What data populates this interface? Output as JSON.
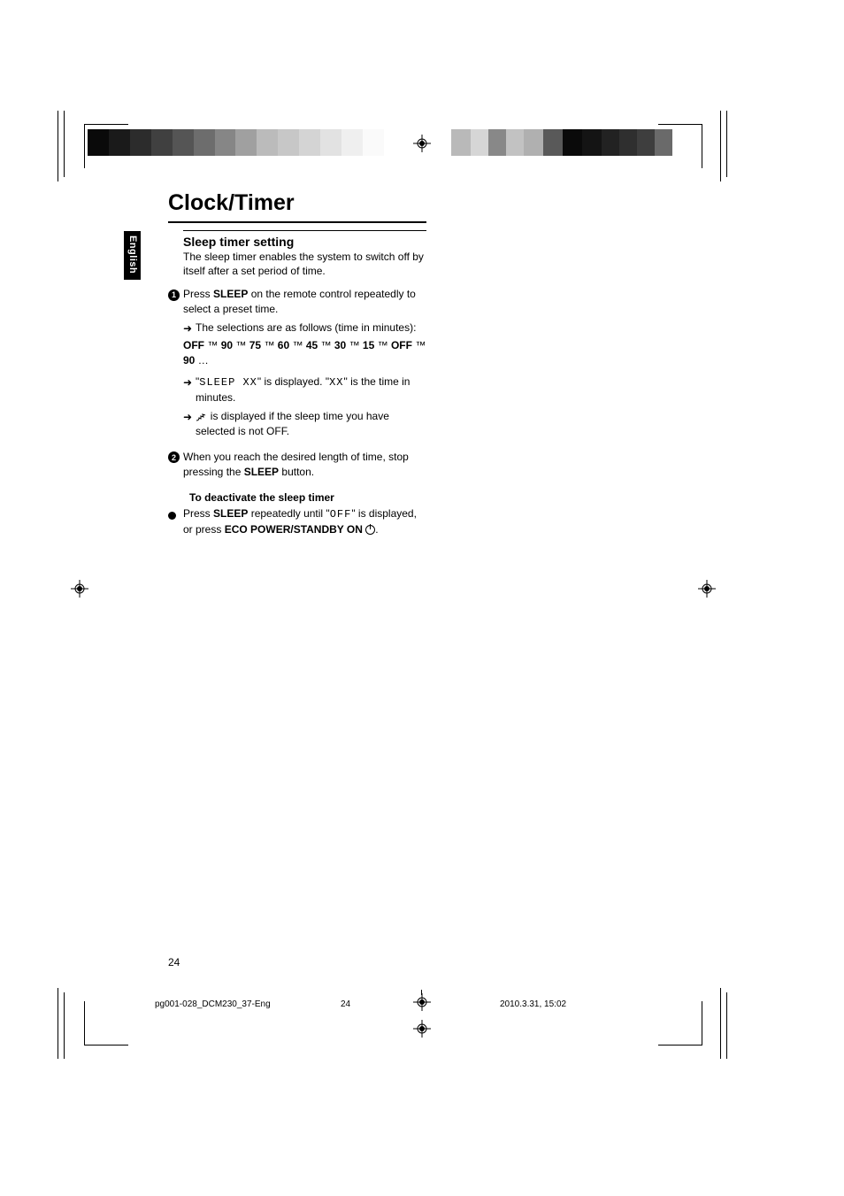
{
  "header": {
    "title": "Clock/Timer"
  },
  "language_tab": "English",
  "section": {
    "heading": "Sleep timer setting",
    "intro": "The sleep timer enables the system to switch off by itself after a set period of time."
  },
  "step1": {
    "text_pre": "Press ",
    "button": "SLEEP",
    "text_post": " on the remote control repeatedly to select a preset time.",
    "sub1": "The selections are as follows (time in minutes):",
    "sequence": {
      "p1": "OFF",
      "p2": "90",
      "p3": "75",
      "p4": "60",
      "p5": "45",
      "p6": "30",
      "p7": "15",
      "p8": "OFF",
      "p9": "90",
      "tail": " …"
    },
    "sub2_pre": "\"",
    "sub2_seg": "SLEEP XX",
    "sub2_mid": "\" is displayed. \"",
    "sub2_seg2": "XX",
    "sub2_post": "\" is the time in minutes.",
    "sub3_post": " is displayed if the sleep time you have selected is not OFF."
  },
  "step2": {
    "text_pre": "When you reach the desired length of time, stop pressing the ",
    "button": "SLEEP",
    "text_post": " button."
  },
  "deactivate": {
    "heading": "To deactivate the sleep timer",
    "bullet_pre": "Press ",
    "b1": "SLEEP",
    "mid1": " repeatedly until \"",
    "seg": "OFF",
    "mid2": "\" is displayed, or press ",
    "b2": "ECO POWER/STANDBY ON",
    "post": "."
  },
  "page_number": "24",
  "footer": {
    "filename": "pg001-028_DCM230_37-Eng",
    "page": "24",
    "datetime": "2010.3.31, 15:02"
  }
}
